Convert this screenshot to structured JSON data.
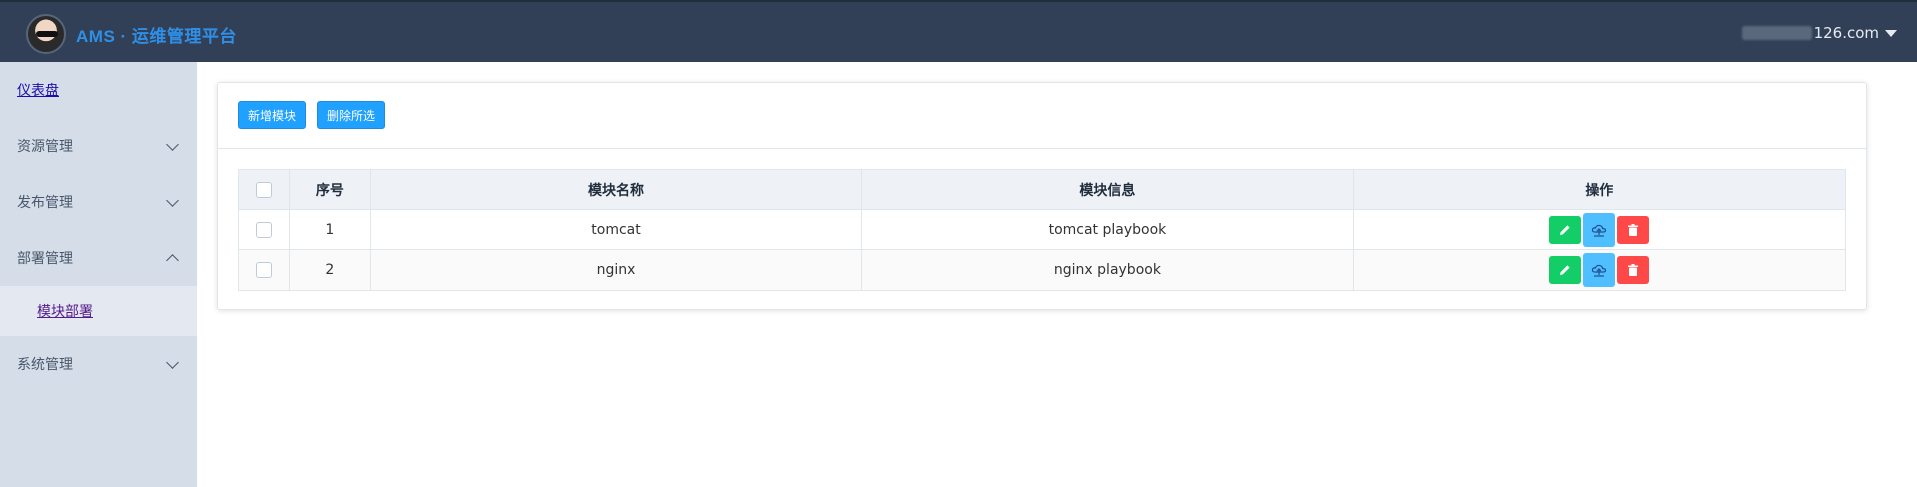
{
  "header": {
    "title": "AMS · 运维管理平台",
    "user_suffix": "126.com"
  },
  "sidebar": {
    "items": [
      {
        "label": "仪表盘"
      },
      {
        "label": "资源管理"
      },
      {
        "label": "发布管理"
      },
      {
        "label": "部署管理"
      },
      {
        "label": "模块部署"
      },
      {
        "label": "系统管理"
      }
    ]
  },
  "toolbar": {
    "add_label": "新增模块",
    "delete_label": "删除所选"
  },
  "table": {
    "columns": [
      "序号",
      "模块名称",
      "模块信息",
      "操作"
    ],
    "rows": [
      {
        "index": "1",
        "name": "tomcat",
        "info": "tomcat playbook"
      },
      {
        "index": "2",
        "name": "nginx",
        "info": "nginx playbook"
      }
    ]
  },
  "colors": {
    "header_bg": "#324057",
    "sidebar_bg": "#d5dde8",
    "primary": "#20a0ff",
    "success": "#13ce66",
    "info": "#50bfff",
    "danger": "#ff4949"
  },
  "icons": {
    "edit": "pencil-icon",
    "deploy": "cloud-icon",
    "delete": "trash-icon"
  }
}
